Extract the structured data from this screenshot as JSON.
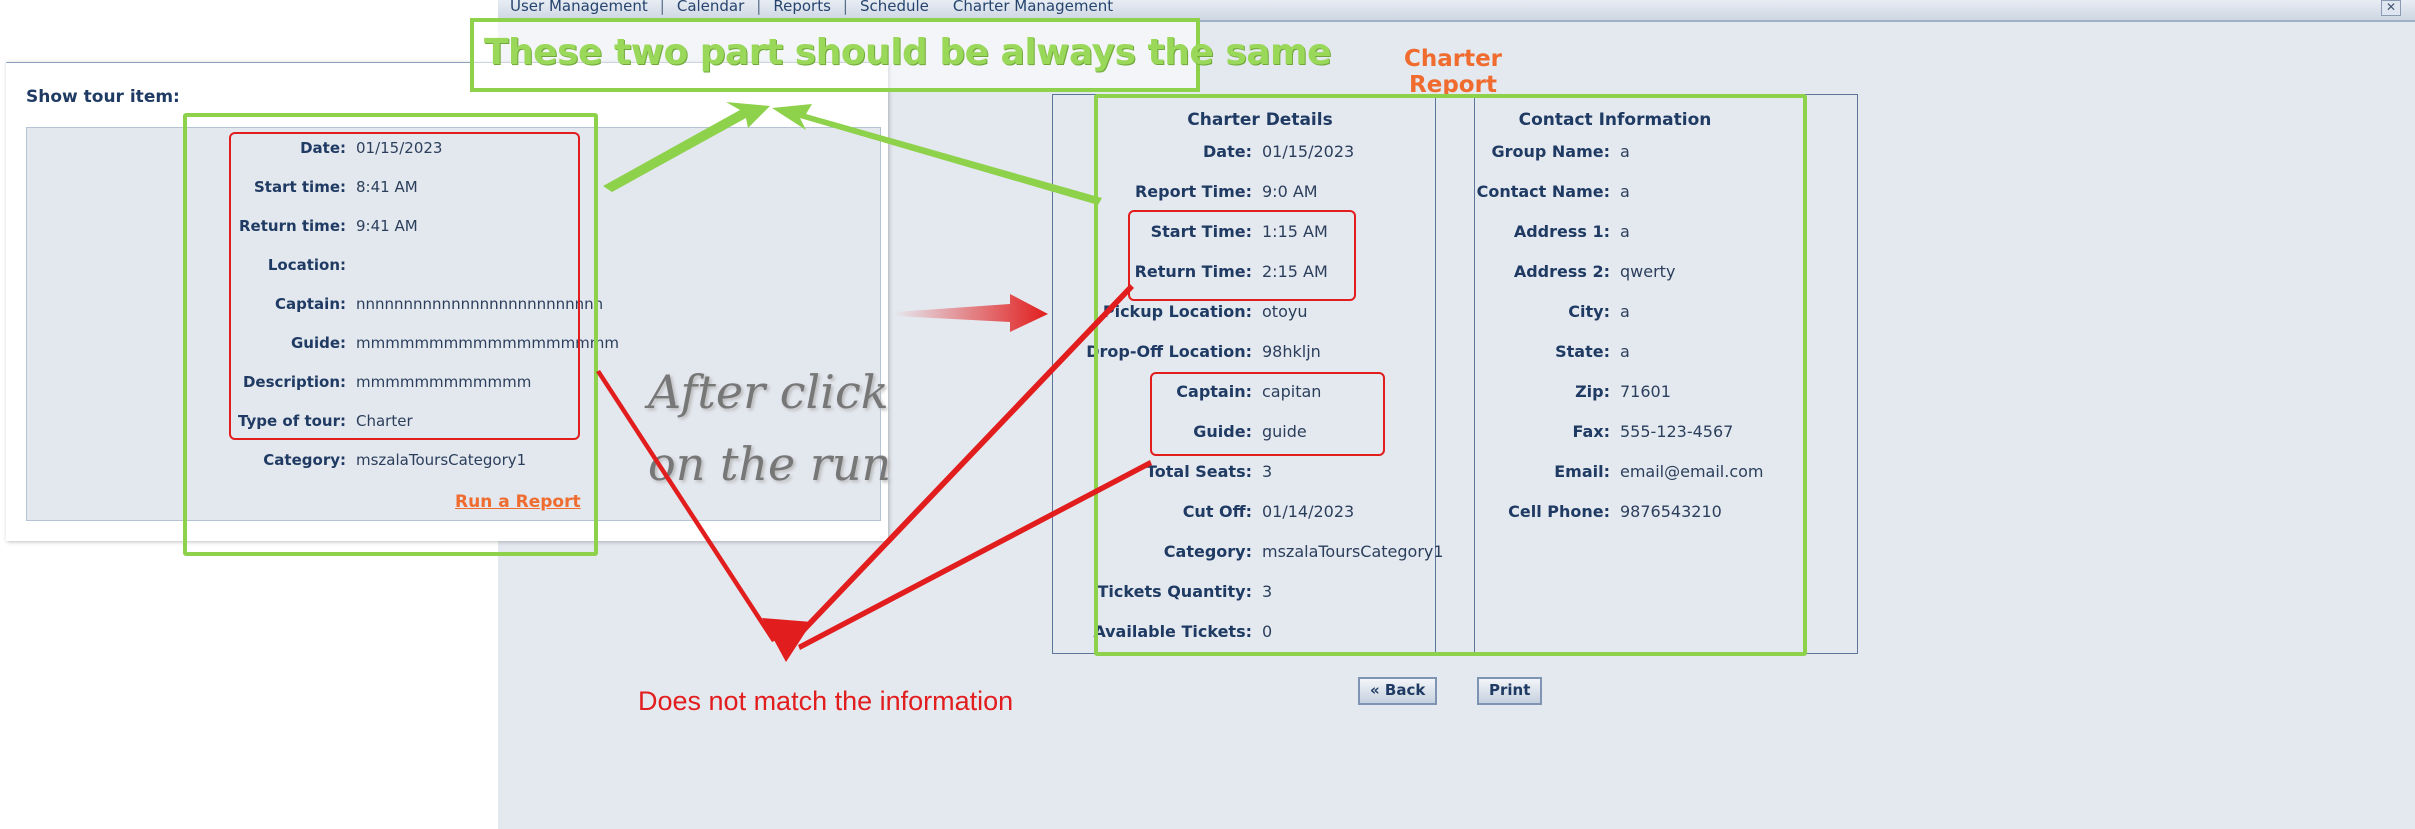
{
  "nav": {
    "items": [
      "User Management",
      "Calendar",
      "Reports",
      "Schedule",
      "Charter Management"
    ],
    "separator": "|",
    "close_symbol": "✕"
  },
  "report": {
    "title": "Charter Report",
    "details_heading": "Charter Details",
    "contact_heading": "Contact Information",
    "details": [
      {
        "label": "Date:",
        "value": "01/15/2023"
      },
      {
        "label": "Report Time:",
        "value": "9:0 AM"
      },
      {
        "label": "Start Time:",
        "value": "1:15 AM"
      },
      {
        "label": "Return Time:",
        "value": "2:15 AM"
      },
      {
        "label": "Pickup Location:",
        "value": "otoyu"
      },
      {
        "label": "Drop-Off Location:",
        "value": "98hkljn"
      },
      {
        "label": "Captain:",
        "value": "capitan"
      },
      {
        "label": "Guide:",
        "value": "guide"
      },
      {
        "label": "Total Seats:",
        "value": "3"
      },
      {
        "label": "Cut Off:",
        "value": "01/14/2023"
      },
      {
        "label": "Category:",
        "value": "mszalaToursCategory1"
      },
      {
        "label": "Tickets Quantity:",
        "value": "3"
      },
      {
        "label": "Available Tickets:",
        "value": "0"
      }
    ],
    "contact": [
      {
        "label": "Group Name:",
        "value": "a"
      },
      {
        "label": "Contact Name:",
        "value": "a"
      },
      {
        "label": "Address 1:",
        "value": "a"
      },
      {
        "label": "Address 2:",
        "value": "qwerty"
      },
      {
        "label": "City:",
        "value": "a"
      },
      {
        "label": "State:",
        "value": "a"
      },
      {
        "label": "Zip:",
        "value": "71601"
      },
      {
        "label": "Fax:",
        "value": "555-123-4567"
      },
      {
        "label": "Email:",
        "value": "email@email.com"
      },
      {
        "label": "Cell Phone:",
        "value": "9876543210"
      }
    ],
    "back_label": "« Back",
    "print_label": "Print"
  },
  "dialog": {
    "title": "Show tour item:",
    "rows": [
      {
        "label": "Date:",
        "value": "01/15/2023"
      },
      {
        "label": "Start time:",
        "value": "8:41 AM"
      },
      {
        "label": "Return time:",
        "value": "9:41 AM"
      },
      {
        "label": "Location:",
        "value": ""
      },
      {
        "label": "Captain:",
        "value": "nnnnnnnnnnnnnnnnnnnnnnnnnn"
      },
      {
        "label": "Guide:",
        "value": "mmmmmmmmmmmmmmmmmm"
      },
      {
        "label": "Description:",
        "value": "mmmmmmmmmmmm"
      },
      {
        "label": "Type of tour:",
        "value": "Charter"
      },
      {
        "label": "Category:",
        "value": "mszalaToursCategory1"
      }
    ],
    "run_report_label": "Run a Report"
  },
  "annotations": {
    "top_note": "These two part should be always the same",
    "click_note_line1": "After click",
    "click_note_line2": "on the run",
    "mismatch_note": "Does not match the information",
    "green": "#8ed14b",
    "red": "#e21d1d"
  }
}
